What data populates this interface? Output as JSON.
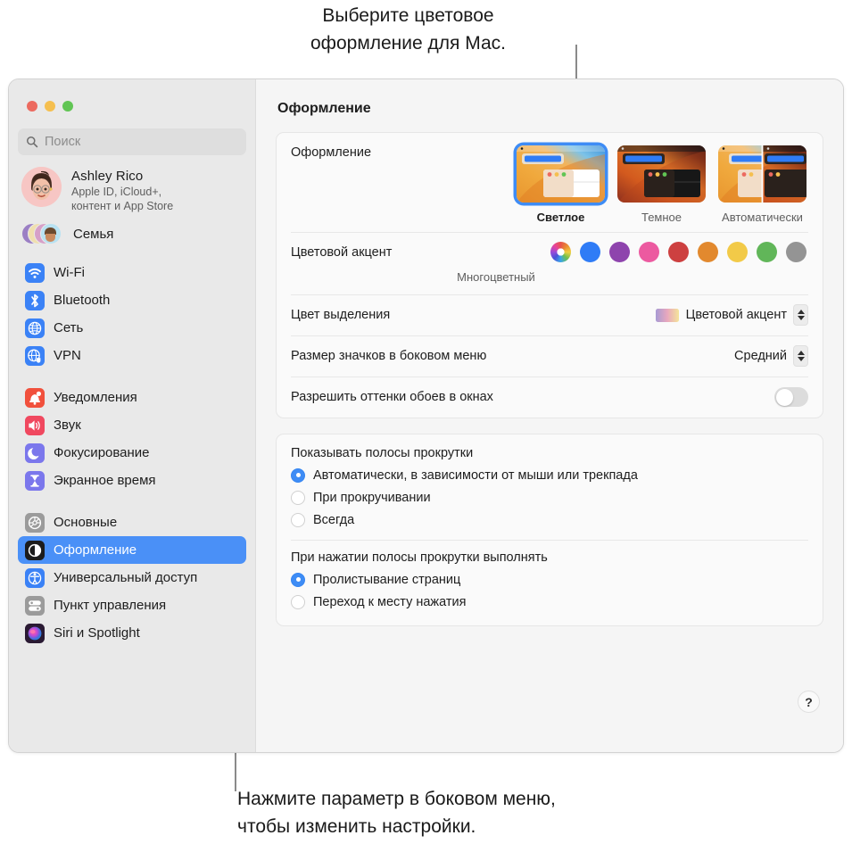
{
  "callouts": {
    "top": "Выберите цветовое\nоформление для Мас.",
    "bottom": "Нажмите параметр в боковом меню,\nчтобы изменить настройки."
  },
  "window": {
    "title": "Оформление",
    "traffic_lights": {
      "close": "close-button",
      "minimize": "minimize-button",
      "zoom": "zoom-button"
    }
  },
  "sidebar": {
    "search": {
      "placeholder": "Поиск",
      "value": ""
    },
    "account": {
      "name": "Ashley Rico",
      "subtitle": "Apple ID, iCloud+,\nконтент и App Store"
    },
    "family": {
      "label": "Семья"
    },
    "group1": [
      {
        "label": "Wi-Fi",
        "icon": "wifi-icon",
        "color": "#3b82f6"
      },
      {
        "label": "Bluetooth",
        "icon": "bluetooth-icon",
        "color": "#3b82f6"
      },
      {
        "label": "Сеть",
        "icon": "network-globe-icon",
        "color": "#3b82f6"
      },
      {
        "label": "VPN",
        "icon": "vpn-icon",
        "color": "#3b82f6"
      }
    ],
    "group2": [
      {
        "label": "Уведомления",
        "icon": "bell-icon",
        "color": "#f1503c"
      },
      {
        "label": "Звук",
        "icon": "speaker-icon",
        "color": "#f0485f"
      },
      {
        "label": "Фокусирование",
        "icon": "moon-icon",
        "color": "#7b77ec"
      },
      {
        "label": "Экранное время",
        "icon": "hourglass-icon",
        "color": "#7b77ec"
      }
    ],
    "group3": [
      {
        "label": "Основные",
        "icon": "gear-icon",
        "color": "#9b9b9b",
        "selected": false
      },
      {
        "label": "Оформление",
        "icon": "appearance-contrast-icon",
        "color": "#1c1c1c",
        "selected": true
      },
      {
        "label": "Универсальный доступ",
        "icon": "accessibility-icon",
        "color": "#3b82f6",
        "selected": false
      },
      {
        "label": "Пункт управления",
        "icon": "control-center-icon",
        "color": "#9b9b9b",
        "selected": false
      },
      {
        "label": "Siri и Spotlight",
        "icon": "siri-icon",
        "color": "#5a3a7a",
        "selected": false
      }
    ]
  },
  "main": {
    "appearance": {
      "label": "Оформление",
      "options": [
        {
          "name": "Светлое",
          "mode": "light",
          "selected": true
        },
        {
          "name": "Темное",
          "mode": "dark",
          "selected": false
        },
        {
          "name": "Автоматически",
          "mode": "auto",
          "selected": false
        }
      ]
    },
    "accent": {
      "label": "Цветовой акцент",
      "caption": "Многоцветный",
      "swatches": [
        {
          "name": "multicolor",
          "color": "multicolor",
          "selected": true
        },
        {
          "name": "blue",
          "color": "#2f7cf6"
        },
        {
          "name": "purple",
          "color": "#8e44ad"
        },
        {
          "name": "pink",
          "color": "#ec5aa0"
        },
        {
          "name": "red",
          "color": "#cd4040"
        },
        {
          "name": "orange",
          "color": "#e2892e"
        },
        {
          "name": "yellow",
          "color": "#f2ca48"
        },
        {
          "name": "green",
          "color": "#61b659"
        },
        {
          "name": "graphite",
          "color": "#949494"
        }
      ]
    },
    "highlight": {
      "label": "Цвет выделения",
      "value": "Цветовой акцент"
    },
    "sidebar_icon_size": {
      "label": "Размер значков в боковом меню",
      "value": "Средний"
    },
    "wallpaper_tinting": {
      "label": "Разрешить оттенки обоев в окнах",
      "state": "off"
    },
    "scrollbars": {
      "title": "Показывать полосы прокрутки",
      "options": [
        {
          "label": "Автоматически, в зависимости от мыши или трекпада",
          "selected": true
        },
        {
          "label": "При прокручивании",
          "selected": false
        },
        {
          "label": "Всегда",
          "selected": false
        }
      ]
    },
    "scroll_click": {
      "title": "При нажатии полосы прокрутки выполнять",
      "options": [
        {
          "label": "Пролистывание страниц",
          "selected": true
        },
        {
          "label": "Переход к месту нажатия",
          "selected": false
        }
      ]
    },
    "help_button": "?"
  },
  "colors": {
    "accent_blue": "#3e8cf5",
    "sidebar_bg": "#e9e9e9",
    "main_bg": "#f5f5f5",
    "card_bg": "#fafafa"
  }
}
